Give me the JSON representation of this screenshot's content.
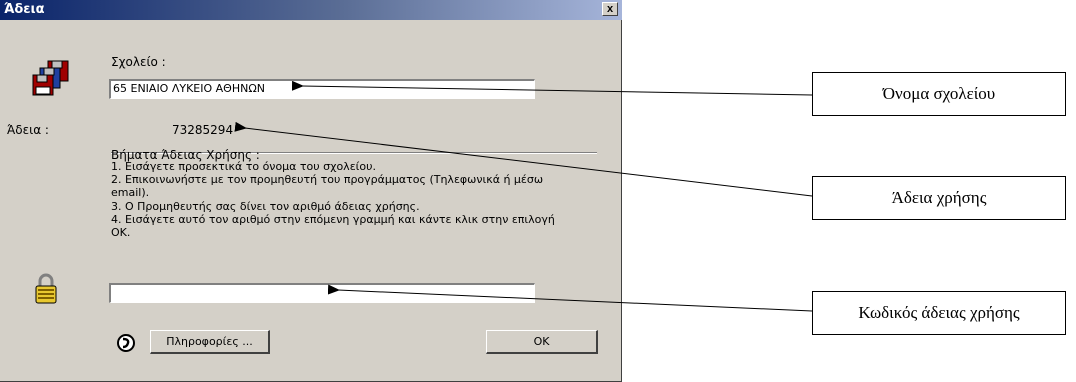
{
  "window": {
    "title": "Άδεια",
    "close_label": "x"
  },
  "form": {
    "school_label": "Σχολείο :",
    "school_value": "65 ΕΝΙΑΙΟ ΛΥΚΕΙΟ ΑΘΗΝΩΝ",
    "license_label": "Άδεια :",
    "license_value": "73285294",
    "steps_title": "Βήματα Άδειας Χρήσης :",
    "steps": [
      "1. Εισάγετε προσεκτικά το όνομα του σχολείου.",
      "2. Επικοινωνήστε με τον προμηθευτή του προγράμματος (Τηλεφωνικά ή μέσω",
      "email).",
      "3. Ο Προμηθευτής σας δίνει τον αριθμό άδειας χρήσης.",
      "4. Εισάγετε αυτό τον αριθμό στην επόμενη γραμμή και κάντε κλικ στην επιλογή",
      "OK."
    ],
    "code_value": ""
  },
  "buttons": {
    "info_label": "Πληροφορίες ...",
    "ok_label": "OK"
  },
  "icons": [
    "floppy-disks-icon",
    "padlock-icon",
    "info-phone-icon"
  ],
  "callouts": {
    "school_name": "Όνομα σχολείου",
    "license": "Άδεια χρήσης",
    "license_code": "Κωδικός άδειας χρήσης"
  },
  "colors": {
    "dialog_bg": "#d4d0c8",
    "title_start": "#0a246a",
    "title_end": "#a6b5da"
  }
}
